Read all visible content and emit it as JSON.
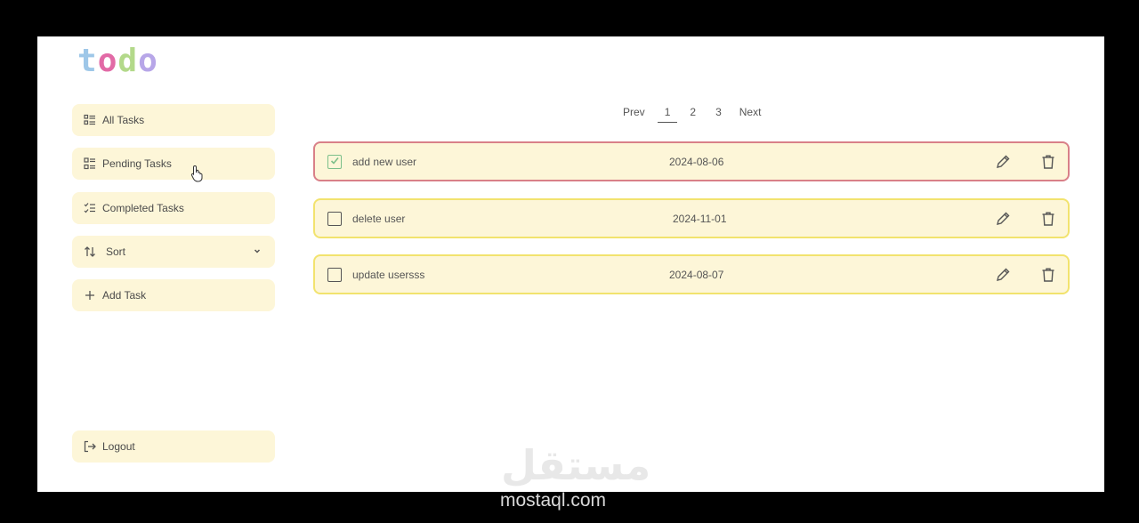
{
  "logo": {
    "letters": [
      "t",
      "o",
      "d",
      "o"
    ],
    "colors": [
      "#9ec7e8",
      "#e26aa6",
      "#b3d98a",
      "#b7a6e8"
    ]
  },
  "sidebar": {
    "items": [
      {
        "label": "All Tasks",
        "icon": "list-icon"
      },
      {
        "label": "Pending Tasks",
        "icon": "grid-list-icon"
      },
      {
        "label": "Completed Tasks",
        "icon": "checklist-icon"
      },
      {
        "label": "Sort",
        "icon": "sort-arrows-icon"
      },
      {
        "label": "Add Task",
        "icon": "plus-icon"
      }
    ],
    "logout": {
      "label": "Logout",
      "icon": "logout-icon"
    }
  },
  "pagination": {
    "prev": "Prev",
    "pages": [
      "1",
      "2",
      "3"
    ],
    "active": "1",
    "next": "Next"
  },
  "tasks": [
    {
      "title": "add new user",
      "date": "2024-08-06",
      "completed": true
    },
    {
      "title": "delete user",
      "date": "2024-11-01",
      "completed": false
    },
    {
      "title": "update usersss",
      "date": "2024-08-07",
      "completed": false
    }
  ],
  "watermark": {
    "arabic": "مستقل",
    "latin": "mostaql.com"
  },
  "colors": {
    "button_bg": "#fdf6d8",
    "task_border": "#f2e36e",
    "selected_border": "#d98088",
    "check_green": "#7cbf8a"
  }
}
